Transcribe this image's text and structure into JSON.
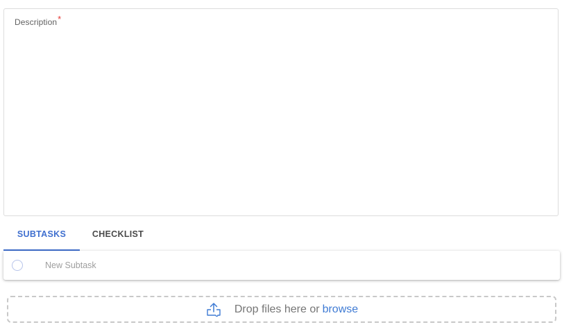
{
  "description": {
    "label": "Description",
    "required_mark": "*",
    "value": ""
  },
  "tabs": [
    {
      "label": "SUBTASKS",
      "active": true
    },
    {
      "label": "CHECKLIST",
      "active": false
    }
  ],
  "subtask": {
    "placeholder": "New Subtask"
  },
  "dropzone": {
    "text": "Drop files here or",
    "browse_label": "browse",
    "icon": "upload-icon"
  },
  "colors": {
    "accent": "#3f6fcf",
    "link": "#3f7bd4",
    "required": "#e53935"
  }
}
